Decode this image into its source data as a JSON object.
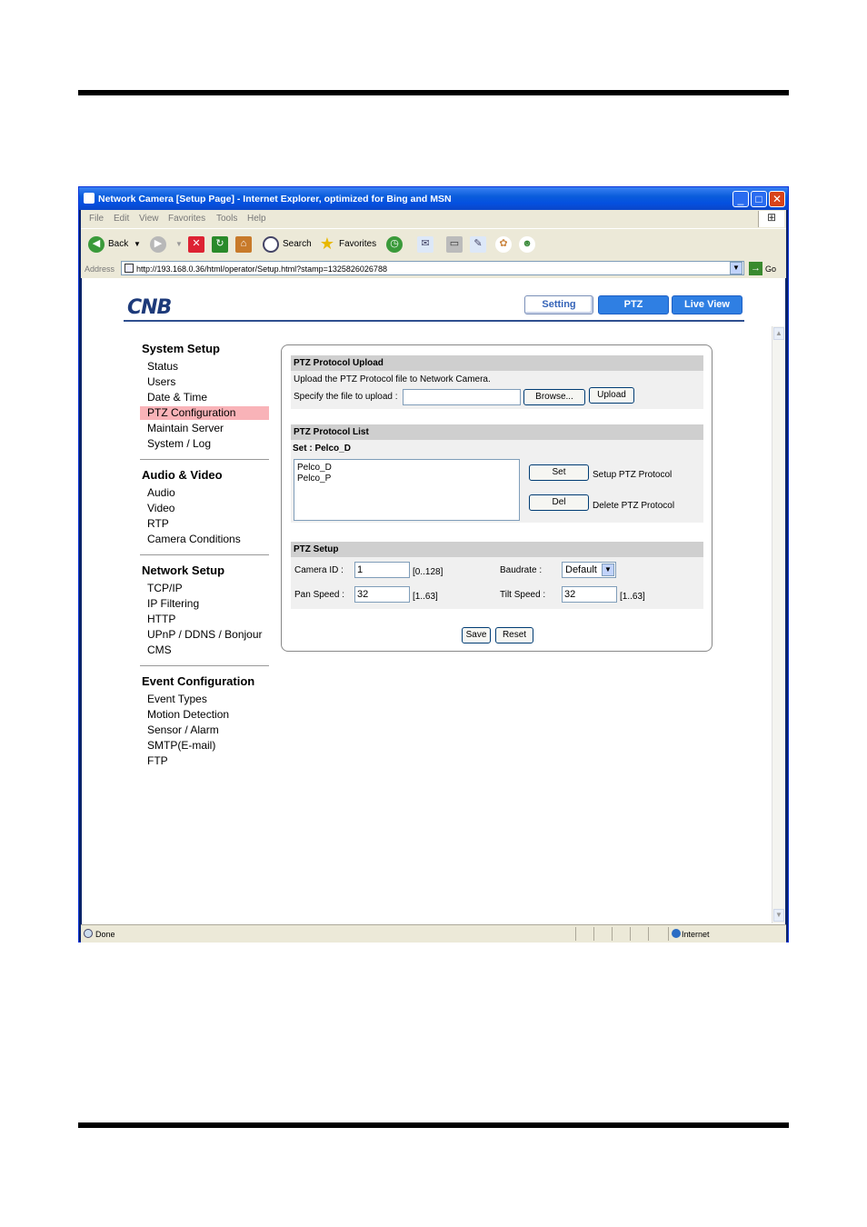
{
  "window": {
    "title": "Network Camera [Setup Page] - Internet Explorer, optimized for Bing and MSN",
    "minimize": "_",
    "maximize": "□",
    "close": "✕"
  },
  "menu": [
    "File",
    "Edit",
    "View",
    "Favorites",
    "Tools",
    "Help"
  ],
  "toolbar": {
    "back": "Back",
    "search": "Search",
    "favorites": "Favorites"
  },
  "address": {
    "label": "Address",
    "url": "http://193.168.0.36/html/operator/Setup.html?stamp=1325826026788",
    "go": "Go"
  },
  "logo": "CNB",
  "tabs": {
    "setting": "Setting",
    "ptz": "PTZ",
    "live": "Live View"
  },
  "nav": {
    "system": {
      "title": "System Setup",
      "items": [
        "Status",
        "Users",
        "Date & Time",
        "PTZ Configuration",
        "Maintain Server",
        "System / Log"
      ]
    },
    "av": {
      "title": "Audio & Video",
      "items": [
        "Audio",
        "Video",
        "RTP",
        "Camera Conditions"
      ]
    },
    "network": {
      "title": "Network Setup",
      "items": [
        "TCP/IP",
        "IP Filtering",
        "HTTP",
        "UPnP / DDNS / Bonjour",
        "CMS"
      ]
    },
    "event": {
      "title": "Event Configuration",
      "items": [
        "Event Types",
        "Motion Detection",
        "Sensor / Alarm",
        "SMTP(E-mail)",
        "FTP"
      ]
    }
  },
  "upload": {
    "title": "PTZ Protocol Upload",
    "description": "Upload the PTZ Protocol file to Network Camera.",
    "specify": "Specify the file to upload :",
    "file_value": "",
    "browse": "Browse...",
    "upload": "Upload"
  },
  "protocol_list": {
    "title": "PTZ Protocol List",
    "set_label": "Set : Pelco_D",
    "items": [
      "Pelco_D",
      "Pelco_P"
    ],
    "set_button": "Set",
    "set_desc": "Setup PTZ Protocol",
    "del_button": "Del",
    "del_desc": "Delete PTZ Protocol"
  },
  "setup": {
    "title": "PTZ Setup",
    "camera_id_label": "Camera ID :",
    "camera_id": "1",
    "camera_id_range": "[0..128]",
    "baudrate_label": "Baudrate :",
    "baudrate": "Default",
    "pan_label": "Pan Speed :",
    "pan": "32",
    "pan_range": "[1..63]",
    "tilt_label": "Tilt Speed :",
    "tilt": "32",
    "tilt_range": "[1..63]",
    "save": "Save",
    "reset": "Reset"
  },
  "status": {
    "done": "Done",
    "zone": "Internet"
  }
}
